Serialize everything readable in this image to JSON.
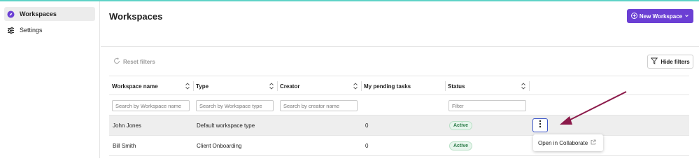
{
  "sidebar": {
    "items": [
      {
        "label": "Workspaces",
        "icon": "compass-icon",
        "active": true
      },
      {
        "label": "Settings",
        "icon": "sliders-icon",
        "active": false
      }
    ]
  },
  "header": {
    "title": "Workspaces",
    "new_button_label": "New Workspace"
  },
  "toolbar": {
    "reset_label": "Reset filters",
    "hide_filters_label": "Hide filters"
  },
  "table": {
    "columns": [
      "Workspace name",
      "Type",
      "Creator",
      "My pending tasks",
      "Status"
    ],
    "filters": {
      "workspace_placeholder": "Search by Workspace name",
      "type_placeholder": "Search by Workspace type",
      "creator_placeholder": "Search by creator name",
      "status_placeholder": "Filter"
    },
    "rows": [
      {
        "name": "John Jones",
        "type": "Default workspace type",
        "creator": "",
        "pending": "0",
        "status": "Active"
      },
      {
        "name": "Bill Smith",
        "type": "Client Onboarding",
        "creator": "",
        "pending": "0",
        "status": "Active"
      }
    ]
  },
  "context_menu": {
    "item_label": "Open in Collaborate"
  },
  "colors": {
    "accent": "#6b3fd4",
    "status_active": "#2e7d4a",
    "annotation_arrow": "#8b1a4a"
  }
}
